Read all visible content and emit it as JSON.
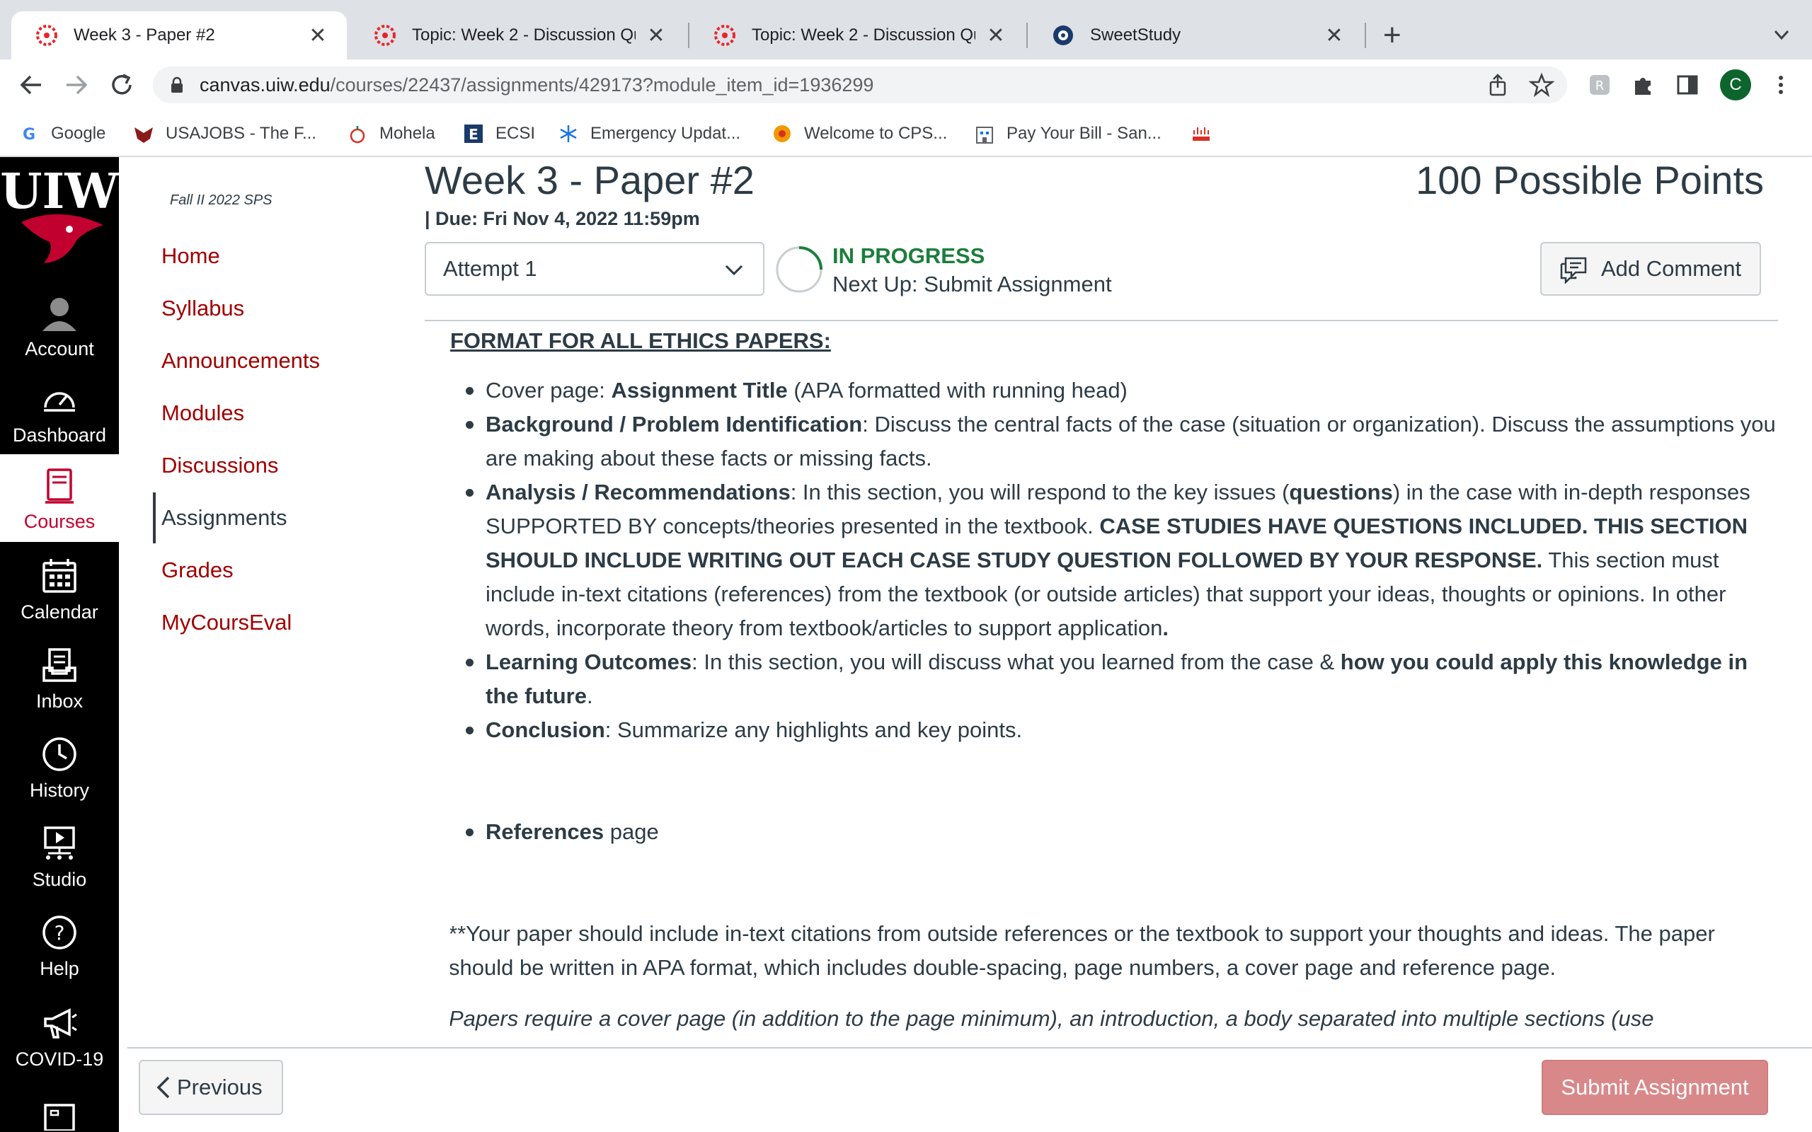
{
  "browser": {
    "tabs": [
      {
        "title": "Week 3 - Paper #2",
        "active": true
      },
      {
        "title": "Topic: Week 2 - Discussion Qu"
      },
      {
        "title": "Topic: Week 2 - Discussion Qu"
      },
      {
        "title": "SweetStudy"
      }
    ],
    "new_tab": "+",
    "close_glyph": "✕",
    "url_host": "canvas.uiw.edu",
    "url_path": "/courses/22437/assignments/429173?module_item_id=1936299",
    "profile_initial": "C",
    "bookmarks": [
      "Google",
      "USAJOBS - The F...",
      "Mohela",
      "ECSI",
      "Emergency Updat...",
      "Welcome to CPS...",
      "Pay Your Bill - San..."
    ]
  },
  "global_nav": {
    "logo_text": "UIW",
    "items": [
      {
        "label": "Account",
        "icon": "account-icon"
      },
      {
        "label": "Dashboard",
        "icon": "dashboard-icon"
      },
      {
        "label": "Courses",
        "icon": "courses-icon",
        "active": true
      },
      {
        "label": "Calendar",
        "icon": "calendar-icon"
      },
      {
        "label": "Inbox",
        "icon": "inbox-icon"
      },
      {
        "label": "History",
        "icon": "history-icon"
      },
      {
        "label": "Studio",
        "icon": "studio-icon"
      },
      {
        "label": "Help",
        "icon": "help-icon"
      },
      {
        "label": "COVID-19",
        "icon": "megaphone-icon"
      }
    ]
  },
  "course_nav": {
    "term": "Fall II 2022 SPS",
    "links": [
      "Home",
      "Syllabus",
      "Announcements",
      "Modules",
      "Discussions",
      "Assignments",
      "Grades",
      "MyCoursEval"
    ],
    "active": "Assignments"
  },
  "assignment": {
    "title": "Week 3 - Paper #2",
    "points": "100 Possible Points",
    "due": "| Due: Fri Nov 4, 2022 11:59pm",
    "attempt": "Attempt 1",
    "status": "IN PROGRESS",
    "next_up": "Next Up: Submit Assignment",
    "add_comment": "Add Comment"
  },
  "content": {
    "heading": "FORMAT FOR ALL ETHICS PAPERS:",
    "b1_a": "Cover page: ",
    "b1_b": "Assignment Title",
    "b1_c": " (APA formatted with running head)",
    "b2_a": "Background / Problem Identification",
    "b2_b": ": Discuss the central facts of the case (situation or organization). Discuss the assumptions you are making about these facts or missing facts.",
    "b3_a": "Analysis / Recommendations",
    "b3_b": ": In this section, you will respond to the key issues (",
    "b3_c": "questions",
    "b3_d": ") in the case with in-depth responses SUPPORTED BY concepts/theories presented in the textbook. ",
    "b3_e": "CASE STUDIES HAVE QUESTIONS INCLUDED.  THIS SECTION SHOULD INCLUDE WRITING OUT EACH CASE STUDY QUESTION FOLLOWED BY YOUR RESPONSE.",
    "b3_f": " This section must include in-text citations (references) from the textbook (or outside articles) that support your ideas, thoughts or opinions. In other words, incorporate theory from textbook/articles to support application",
    "b3_g": ".",
    "b4_a": "Learning Outcomes",
    "b4_b": ": In this section, you will discuss what you learned from the case & ",
    "b4_c": "how you could apply this knowledge in the future",
    "b4_d": ".",
    "b5_a": "Conclusion",
    "b5_b": ": Summarize any highlights and key points.",
    "b6_a": "References",
    "b6_b": " page",
    "note": "**Your paper should include in-text citations from outside references or the textbook to support your thoughts and ideas.  The paper should be written in APA format, which includes double-spacing, page numbers, a cover page and reference page.",
    "italic": "Papers require a cover page (in addition to the page minimum), an introduction, a body separated into multiple sections (use subheadings provided), and a separate References page. Papers should include multiple references (tie in concepts/theory from the textbook to the"
  },
  "footer": {
    "previous": "Previous",
    "submit": "Submit Assignment"
  },
  "colors": {
    "canvas_red": "#a00000",
    "status_green": "#1b7e3b",
    "nav_black": "#000000",
    "submit_disabled": "#d9888a"
  }
}
